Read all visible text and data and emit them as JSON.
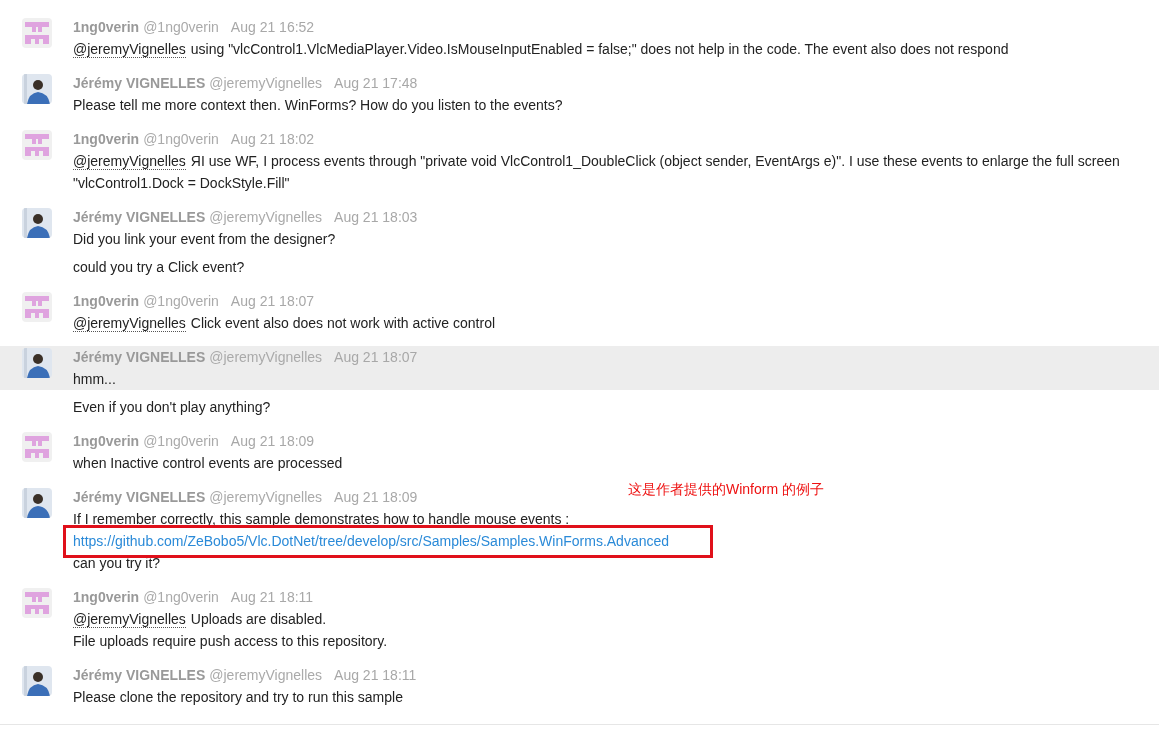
{
  "messages": [
    {
      "kind": "identicon",
      "name": "1ng0verin",
      "handle": "@1ng0verin",
      "time": "Aug 21 16:52",
      "blocks": [
        {
          "highlighted": false,
          "lines": [
            {
              "kind": "text",
              "mention": "@jeremyVignelles",
              "text": "using \"vlcControl1.VlcMediaPlayer.Video.IsMouseInputEnabled = false;\" does not help in the code. The event also does not respond"
            }
          ]
        }
      ]
    },
    {
      "kind": "photo",
      "name": "Jérémy VIGNELLES",
      "handle": "@jeremyVignelles",
      "time": "Aug 21 17:48",
      "blocks": [
        {
          "highlighted": false,
          "lines": [
            {
              "kind": "text",
              "text": "Please tell me more context then. WinForms? How do you listen to the events?"
            }
          ]
        }
      ]
    },
    {
      "kind": "identicon",
      "name": "1ng0verin",
      "handle": "@1ng0verin",
      "time": "Aug 21 18:02",
      "blocks": [
        {
          "highlighted": false,
          "lines": [
            {
              "kind": "text",
              "mention": "@jeremyVignelles",
              "text": "ЯI use WF, I process events through \"private void VlcControl1_DoubleClick (object sender, EventArgs e)\". I use these events to enlarge the full screen \"vlcControl1.Dock = DockStyle.Fill\""
            }
          ]
        }
      ]
    },
    {
      "kind": "photo",
      "name": "Jérémy VIGNELLES",
      "handle": "@jeremyVignelles",
      "time": "Aug 21 18:03",
      "blocks": [
        {
          "highlighted": false,
          "lines": [
            {
              "kind": "text",
              "text": "Did you link your event from the designer?"
            }
          ]
        },
        {
          "highlighted": false,
          "lines": [
            {
              "kind": "text",
              "text": "could you try a Click event?"
            }
          ]
        }
      ]
    },
    {
      "kind": "identicon",
      "name": "1ng0verin",
      "handle": "@1ng0verin",
      "time": "Aug 21 18:07",
      "blocks": [
        {
          "highlighted": false,
          "lines": [
            {
              "kind": "text",
              "mention": "@jeremyVignelles",
              "text": "Click event also does not work with active control"
            }
          ]
        }
      ]
    },
    {
      "kind": "photo",
      "name": "Jérémy VIGNELLES",
      "handle": "@jeremyVignelles",
      "time": "Aug 21 18:07",
      "blocks": [
        {
          "highlighted": true,
          "lines": [
            {
              "kind": "text",
              "text": "hmm..."
            }
          ]
        },
        {
          "highlighted": false,
          "lines": [
            {
              "kind": "text",
              "text": "Even if you don't play anything?"
            }
          ]
        }
      ]
    },
    {
      "kind": "identicon",
      "name": "1ng0verin",
      "handle": "@1ng0verin",
      "time": "Aug 21 18:09",
      "blocks": [
        {
          "highlighted": false,
          "lines": [
            {
              "kind": "text",
              "text": "when Inactive control events are processed"
            }
          ]
        }
      ]
    },
    {
      "kind": "photo",
      "name": "Jérémy VIGNELLES",
      "handle": "@jeremyVignelles",
      "time": "Aug 21 18:09",
      "annotation": "这是作者提供的Winform 的例子",
      "blocks": [
        {
          "highlighted": false,
          "lines": [
            {
              "kind": "text",
              "text": "If I remember correctly, this sample demonstrates how to handle mouse events :"
            },
            {
              "kind": "link",
              "boxed": true,
              "text": "https://github.com/ZeBobo5/Vlc.DotNet/tree/develop/src/Samples/Samples.WinForms.Advanced"
            },
            {
              "kind": "text",
              "text": "can you try it?"
            }
          ]
        }
      ]
    },
    {
      "kind": "identicon",
      "name": "1ng0verin",
      "handle": "@1ng0verin",
      "time": "Aug 21 18:11",
      "blocks": [
        {
          "highlighted": false,
          "lines": [
            {
              "kind": "text",
              "mention": "@jeremyVignelles",
              "text": "Uploads are disabled."
            },
            {
              "kind": "text",
              "text": "File uploads require push access to this repository."
            }
          ]
        }
      ]
    },
    {
      "kind": "photo",
      "name": "Jérémy VIGNELLES",
      "handle": "@jeremyVignelles",
      "time": "Aug 21 18:11",
      "blocks": [
        {
          "highlighted": false,
          "lines": [
            {
              "kind": "text",
              "text": "Please clone the repository and try to run this sample"
            }
          ]
        }
      ]
    }
  ]
}
